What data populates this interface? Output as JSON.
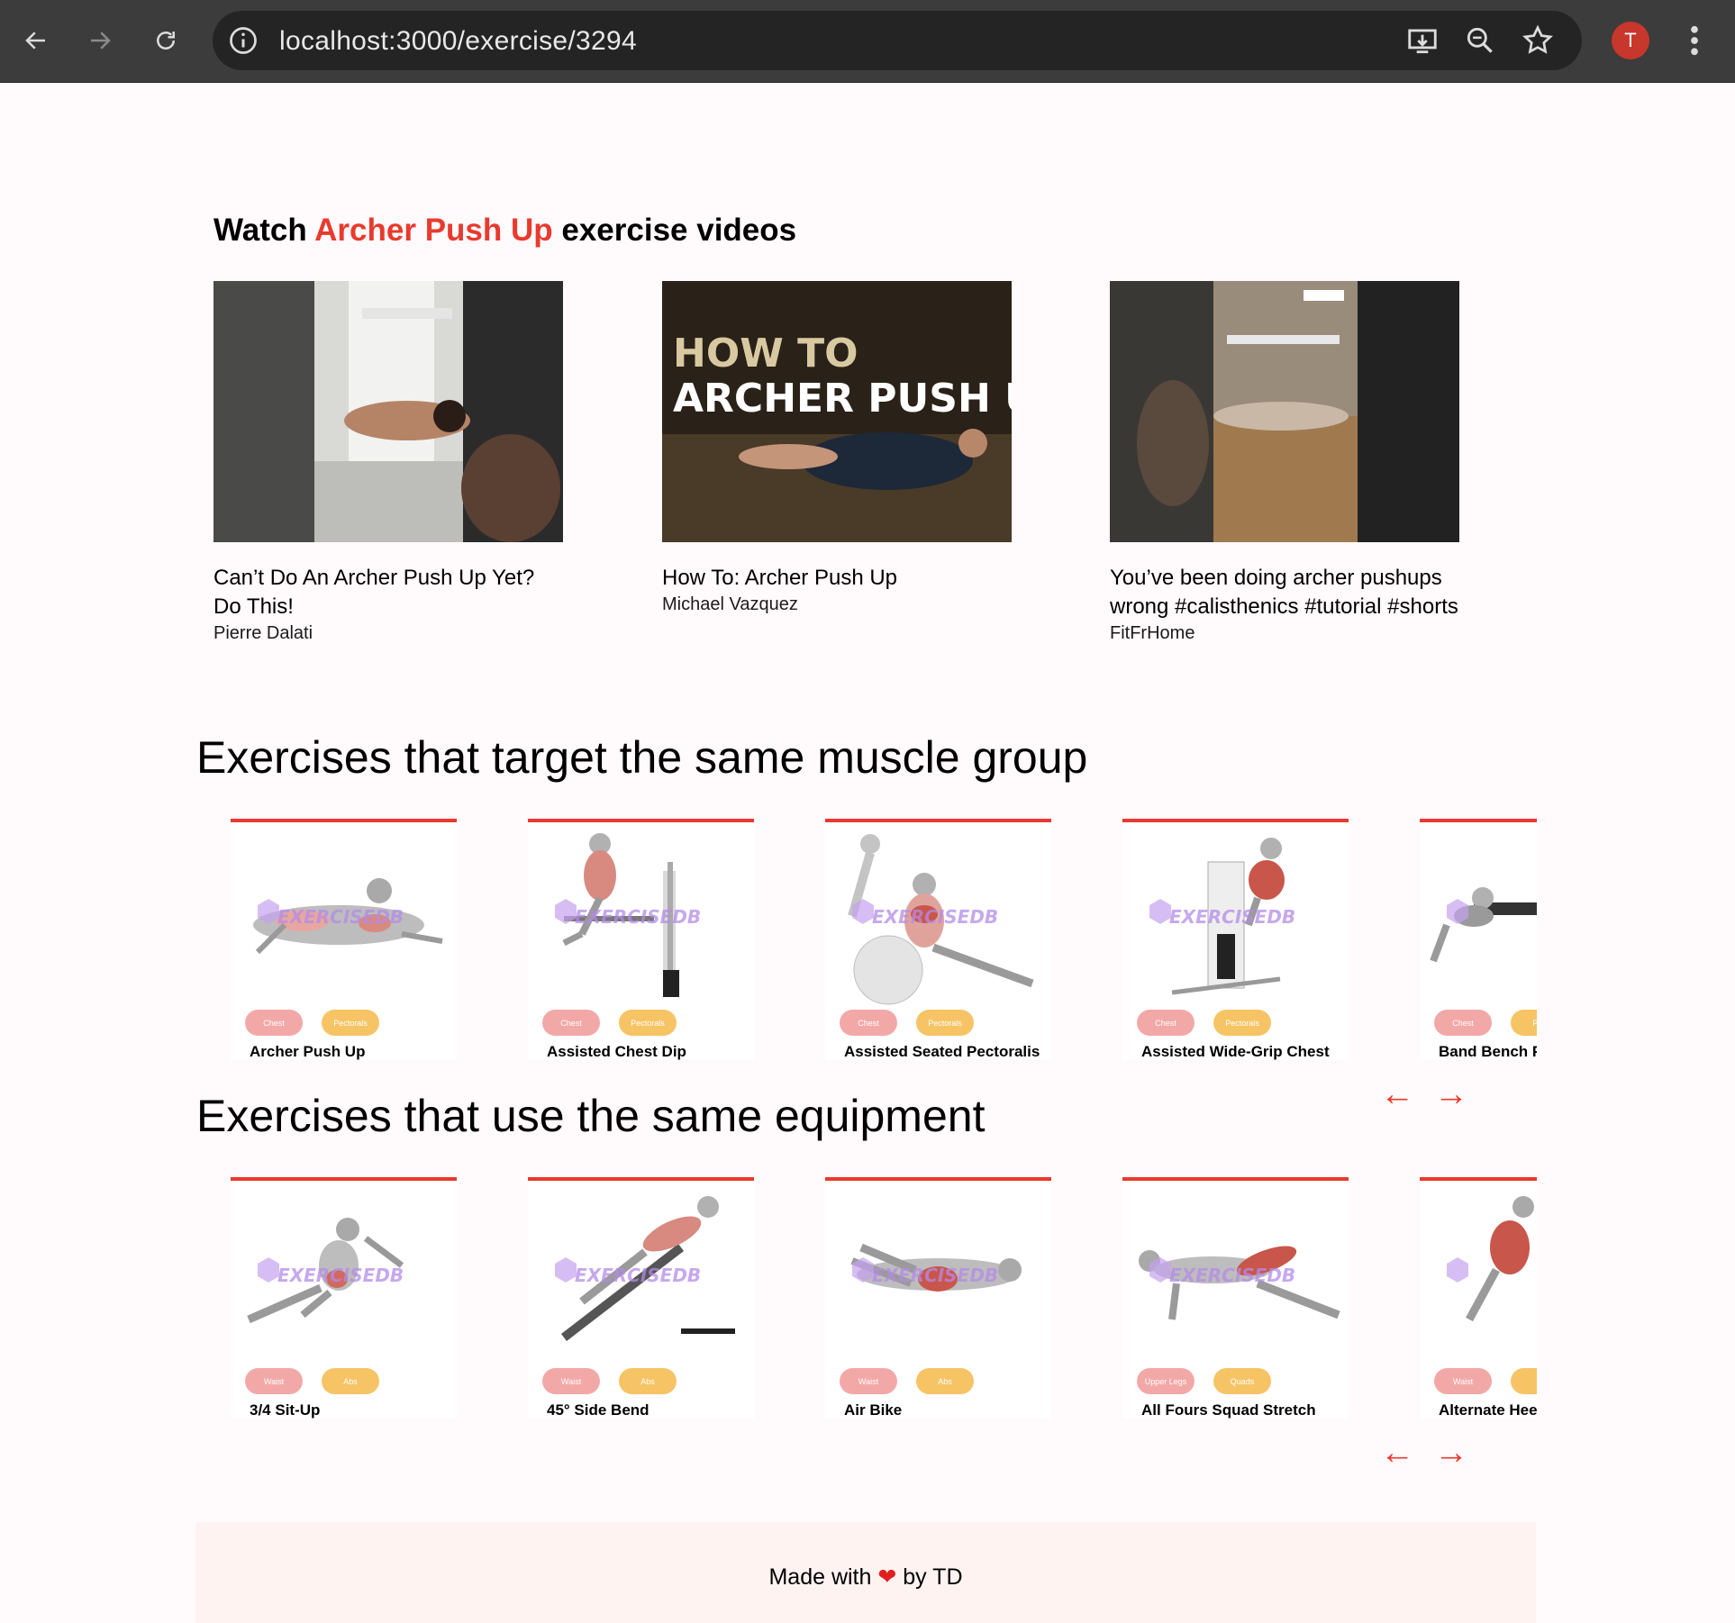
{
  "browser": {
    "url": "localhost:3000/exercise/3294",
    "avatar_letter": "T"
  },
  "videos": {
    "title_prefix": "Watch",
    "title_highlight": "Archer Push Up",
    "title_suffix": "exercise videos",
    "items": [
      {
        "title": "Can’t Do An Archer Push Up Yet? Do This!",
        "channel": "Pierre Dalati"
      },
      {
        "title": "How To: Archer Push Up",
        "channel": "Michael Vazquez",
        "thumb_text_line1": "HOW TO",
        "thumb_text_line2": "ARCHER PUSH UP"
      },
      {
        "title": "You’ve been doing archer pushups wrong #calisthenics #tutorial #shorts",
        "channel": "FitFrHome"
      }
    ]
  },
  "muscle_section": {
    "title": "Exercises that target the same muscle group",
    "cards": [
      {
        "name": "Archer Push Up",
        "badge1": "Chest",
        "badge2": "Pectorals"
      },
      {
        "name": "Assisted Chest Dip",
        "badge1": "Chest",
        "badge2": "Pectorals"
      },
      {
        "name": "Assisted Seated Pectoralis",
        "badge1": "Chest",
        "badge2": "Pectorals"
      },
      {
        "name": "Assisted Wide-Grip Chest",
        "badge1": "Chest",
        "badge2": "Pectorals"
      },
      {
        "name": "Band Bench P",
        "badge1": "Chest",
        "badge2": "Pec"
      }
    ],
    "prev_arrow": "←",
    "next_arrow": "→"
  },
  "equipment_section": {
    "title": "Exercises that use the same equipment",
    "cards": [
      {
        "name": "3/4 Sit-Up",
        "badge1": "Waist",
        "badge2": "Abs"
      },
      {
        "name": "45° Side Bend",
        "badge1": "Waist",
        "badge2": "Abs"
      },
      {
        "name": "Air Bike",
        "badge1": "Waist",
        "badge2": "Abs"
      },
      {
        "name": "All Fours Squad Stretch",
        "badge1": "Upper Legs",
        "badge2": "Quads"
      },
      {
        "name": "Alternate Heel",
        "badge1": "Waist",
        "badge2": "A"
      }
    ],
    "prev_arrow": "←",
    "next_arrow": "→"
  },
  "watermark": "EXERCISEDB",
  "footer": {
    "before": "Made with",
    "heart": "❤",
    "after": "by TD"
  },
  "colors": {
    "accent": "#e83a2e",
    "badge_primary": "#f3a8a8",
    "badge_secondary": "#f6c465",
    "chrome": "#3c3c3c"
  }
}
